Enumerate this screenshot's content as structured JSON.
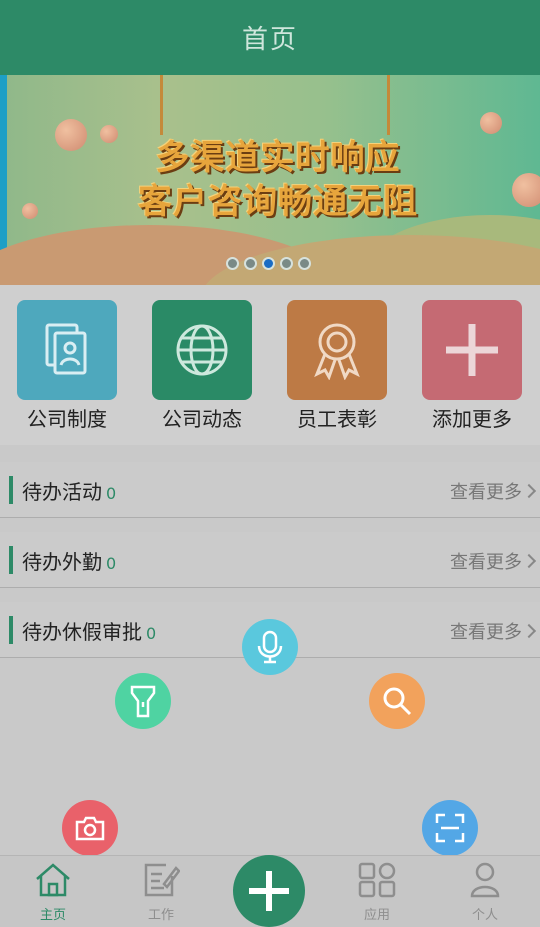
{
  "header": {
    "title": "首页"
  },
  "banner": {
    "line1": "多渠道实时响应",
    "line2": "客户咨询畅通无阻",
    "slides": 5,
    "active_slide": 3
  },
  "quick_items": [
    {
      "label": "公司制度",
      "icon": "document-icon",
      "color": "#4ea8bd"
    },
    {
      "label": "公司动态",
      "icon": "globe-icon",
      "color": "#2a8a66"
    },
    {
      "label": "员工表彰",
      "icon": "award-icon",
      "color": "#bd7a45"
    },
    {
      "label": "添加更多",
      "icon": "plus-icon",
      "color": "#c56a73"
    }
  ],
  "sections": [
    {
      "title": "待办活动",
      "count": "0",
      "more": "查看更多"
    },
    {
      "title": "待办外勤",
      "count": "0",
      "more": "查看更多"
    },
    {
      "title": "待办休假审批",
      "count": "0",
      "more": "查看更多"
    }
  ],
  "fabs": [
    {
      "name": "microphone-icon",
      "color": "#5ac8dd"
    },
    {
      "name": "flashlight-icon",
      "color": "#4fd3a2"
    },
    {
      "name": "search-icon",
      "color": "#f2a25c"
    },
    {
      "name": "camera-icon",
      "color": "#e9616a"
    },
    {
      "name": "scan-icon",
      "color": "#53a7e6"
    }
  ],
  "tabbar": [
    {
      "label": "主页",
      "icon": "home-icon",
      "active": true
    },
    {
      "label": "工作",
      "icon": "edit-icon",
      "active": false
    },
    {
      "label": "应用",
      "icon": "apps-icon",
      "active": false
    },
    {
      "label": "个人",
      "icon": "user-icon",
      "active": false
    }
  ],
  "colors": {
    "primary": "#2d8a67",
    "background": "#c9c9c9"
  }
}
